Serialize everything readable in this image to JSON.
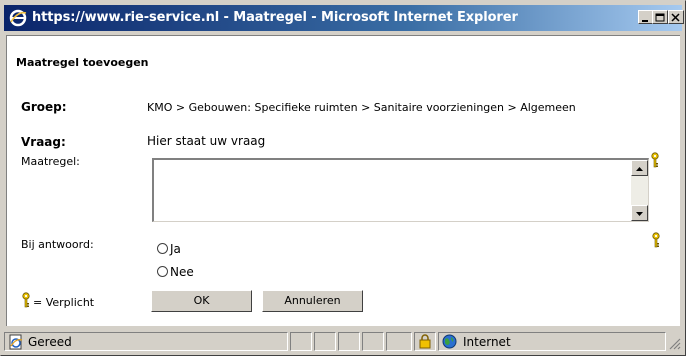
{
  "window": {
    "title": "https://www.rie-service.nl - Maatregel - Microsoft Internet Explorer"
  },
  "form": {
    "heading": "Maatregel toevoegen",
    "groep_label": "Groep:",
    "groep_value": "KMO > Gebouwen: Specifieke ruimten > Sanitaire voorzieningen > Algemeen",
    "vraag_label": "Vraag:",
    "vraag_value": "Hier staat uw vraag",
    "maatregel_label": "Maatregel:",
    "maatregel_value": "",
    "antwoord_label": "Bij antwoord:",
    "options": [
      "Ja",
      "Nee"
    ],
    "legend_text": "= Verplicht",
    "ok_label": "OK",
    "cancel_label": "Annuleren"
  },
  "status": {
    "text": "Gereed",
    "zone": "Internet"
  },
  "colors": {
    "title_start": "#0a246a",
    "title_end": "#a6caf0",
    "chrome": "#d4d0c8",
    "required_key": "#e8c000"
  }
}
